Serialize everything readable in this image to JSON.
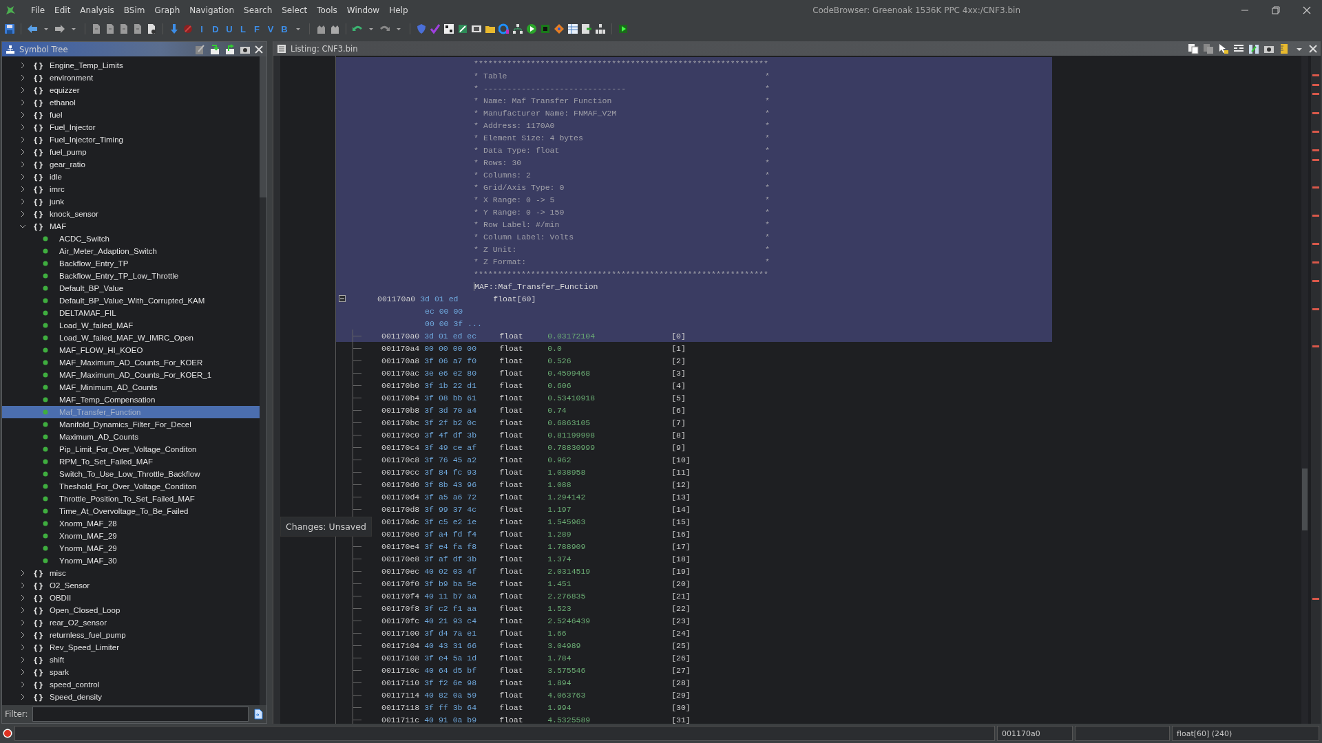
{
  "window": {
    "title": "CodeBrowser: Greenoak 1536K PPC 4xx:/CNF3.bin"
  },
  "menu": [
    "File",
    "Edit",
    "Analysis",
    "BSim",
    "Graph",
    "Navigation",
    "Search",
    "Select",
    "Tools",
    "Window",
    "Help"
  ],
  "toolbar": {
    "letters": [
      "I",
      "D",
      "U",
      "L",
      "F",
      "V",
      "B"
    ]
  },
  "symbol_tree": {
    "title": "Symbol Tree",
    "filter": {
      "label": "Filter:"
    },
    "items": [
      {
        "glyph": "{}",
        "label": "Engine_Temp_Limits",
        "expanded": false,
        "selected": false
      },
      {
        "glyph": "{}",
        "label": "environment",
        "expanded": false,
        "selected": false
      },
      {
        "glyph": "{}",
        "label": "equizzer",
        "expanded": false,
        "selected": false
      },
      {
        "glyph": "{}",
        "label": "ethanol",
        "expanded": false,
        "selected": false
      },
      {
        "glyph": "{}",
        "label": "fuel",
        "expanded": false,
        "selected": false
      },
      {
        "glyph": "{}",
        "label": "Fuel_Injector",
        "expanded": false,
        "selected": false
      },
      {
        "glyph": "{}",
        "label": "Fuel_Injector_Timing",
        "expanded": false,
        "selected": false
      },
      {
        "glyph": "{}",
        "label": "fuel_pump",
        "expanded": false,
        "selected": false
      },
      {
        "glyph": "{}",
        "label": "gear_ratio",
        "expanded": false,
        "selected": false
      },
      {
        "glyph": "{}",
        "label": "idle",
        "expanded": false,
        "selected": false
      },
      {
        "glyph": "{}",
        "label": "imrc",
        "expanded": false,
        "selected": false
      },
      {
        "glyph": "{}",
        "label": "junk",
        "expanded": false,
        "selected": false
      },
      {
        "glyph": "{}",
        "label": "knock_sensor",
        "expanded": false,
        "selected": false
      },
      {
        "glyph": "{}",
        "label": "MAF",
        "expanded": true,
        "selected": false,
        "children": [
          {
            "label": "ACDC_Switch",
            "selected": false
          },
          {
            "label": "Air_Meter_Adaption_Switch",
            "selected": false
          },
          {
            "label": "Backflow_Entry_TP",
            "selected": false
          },
          {
            "label": "Backflow_Entry_TP_Low_Throttle",
            "selected": false
          },
          {
            "label": "Default_BP_Value",
            "selected": false
          },
          {
            "label": "Default_BP_Value_With_Corrupted_KAM",
            "selected": false
          },
          {
            "label": "DELTAMAF_FIL",
            "selected": false
          },
          {
            "label": "Load_W_failed_MAF",
            "selected": false
          },
          {
            "label": "Load_W_failed_MAF_W_IMRC_Open",
            "selected": false
          },
          {
            "label": "MAF_FLOW_HI_KOEO",
            "selected": false
          },
          {
            "label": "MAF_Maximum_AD_Counts_For_KOER",
            "selected": false
          },
          {
            "label": "MAF_Maximum_AD_Counts_For_KOER_1",
            "selected": false
          },
          {
            "label": "MAF_Minimum_AD_Counts",
            "selected": false
          },
          {
            "label": "MAF_Temp_Compensation",
            "selected": false
          },
          {
            "label": "Maf_Transfer_Function",
            "selected": true
          },
          {
            "label": "Manifold_Dynamics_Filter_For_Decel",
            "selected": false
          },
          {
            "label": "Maximum_AD_Counts",
            "selected": false
          },
          {
            "label": "Pip_Limit_For_Over_Voltage_Conditon",
            "selected": false
          },
          {
            "label": "RPM_To_Set_Failed_MAF",
            "selected": false
          },
          {
            "label": "Switch_To_Use_Low_Throttle_Backflow",
            "selected": false
          },
          {
            "label": "Theshold_For_Over_Voltage_Conditon",
            "selected": false
          },
          {
            "label": "Throttle_Position_To_Set_Failed_MAF",
            "selected": false
          },
          {
            "label": "Time_At_Overvoltage_To_Be_Failed",
            "selected": false
          },
          {
            "label": "Xnorm_MAF_28",
            "selected": false
          },
          {
            "label": "Xnorm_MAF_29",
            "selected": false
          },
          {
            "label": "Ynorm_MAF_29",
            "selected": false
          },
          {
            "label": "Ynorm_MAF_30",
            "selected": false
          }
        ]
      },
      {
        "glyph": "{}",
        "label": "misc",
        "expanded": false,
        "selected": false
      },
      {
        "glyph": "{}",
        "label": "O2_Sensor",
        "expanded": false,
        "selected": false
      },
      {
        "glyph": "{}",
        "label": "OBDII",
        "expanded": false,
        "selected": false
      },
      {
        "glyph": "{}",
        "label": "Open_Closed_Loop",
        "expanded": false,
        "selected": false
      },
      {
        "glyph": "{}",
        "label": "rear_O2_sensor",
        "expanded": false,
        "selected": false
      },
      {
        "glyph": "{}",
        "label": "returnless_fuel_pump",
        "expanded": false,
        "selected": false
      },
      {
        "glyph": "{}",
        "label": "Rev_Speed_Limiter",
        "expanded": false,
        "selected": false
      },
      {
        "glyph": "{}",
        "label": "shift",
        "expanded": false,
        "selected": false
      },
      {
        "glyph": "{}",
        "label": "spark",
        "expanded": false,
        "selected": false
      },
      {
        "glyph": "{}",
        "label": "speed_control",
        "expanded": false,
        "selected": false
      },
      {
        "glyph": "{}",
        "label": "Speed_density",
        "expanded": false,
        "selected": false
      }
    ]
  },
  "listing": {
    "title": "Listing:  CNF3.bin",
    "tooltip": "Changes: Unsaved",
    "lines": [
      {
        "kind": "border",
        "text": "**************************************************************",
        "selected": true
      },
      {
        "kind": "comment",
        "left": "*",
        "text": "Table",
        "right": "*",
        "selected": true
      },
      {
        "kind": "comment",
        "left": "*",
        "text": "------------------------------",
        "right": "*",
        "selected": true
      },
      {
        "kind": "comment",
        "left": "*",
        "text": "Name: Maf Transfer Function",
        "right": "*",
        "selected": true
      },
      {
        "kind": "comment",
        "left": "*",
        "text": "Manufacturer Name: FNMAF_V2M",
        "right": "*",
        "selected": true
      },
      {
        "kind": "comment",
        "left": "*",
        "text": "Address: 1170A0",
        "right": "*",
        "selected": true
      },
      {
        "kind": "comment",
        "left": "*",
        "text": "Element Size: 4 bytes",
        "right": "*",
        "selected": true
      },
      {
        "kind": "comment",
        "left": "*",
        "text": "Data Type: float",
        "right": "*",
        "selected": true
      },
      {
        "kind": "comment",
        "left": "*",
        "text": "Rows: 30",
        "right": "*",
        "selected": true
      },
      {
        "kind": "comment",
        "left": "*",
        "text": "Columns: 2",
        "right": "*",
        "selected": true
      },
      {
        "kind": "comment",
        "left": "*",
        "text": "Grid/Axis Type: 0",
        "right": "*",
        "selected": true
      },
      {
        "kind": "comment",
        "left": "*",
        "text": "X Range: 0 -> 5",
        "right": "*",
        "selected": true
      },
      {
        "kind": "comment",
        "left": "*",
        "text": "Y Range: 0 -> 150",
        "right": "*",
        "selected": true
      },
      {
        "kind": "comment",
        "left": "*",
        "text": "Row Label: #/min",
        "right": "*",
        "selected": true
      },
      {
        "kind": "comment",
        "left": "*",
        "text": "Column Label: Volts",
        "right": "*",
        "selected": true
      },
      {
        "kind": "comment",
        "left": "*",
        "text": "Z Unit:",
        "right": "*",
        "selected": true
      },
      {
        "kind": "comment",
        "left": "*",
        "text": "Z Format:",
        "right": "*",
        "selected": true
      },
      {
        "kind": "border",
        "text": "**************************************************************",
        "selected": true
      },
      {
        "kind": "label",
        "text": "MAF::Maf_Transfer_Function",
        "selected": true
      },
      {
        "kind": "data",
        "address": "001170a0",
        "bytes": "3d 01 ed",
        "type": "float[60]",
        "selected": true
      },
      {
        "kind": "bytes",
        "bytes": "ec 00 00",
        "selected": true
      },
      {
        "kind": "bytes",
        "bytes": "00 00 3f ...",
        "selected": true
      },
      {
        "kind": "element",
        "address": "001170a0",
        "bytes": "3d 01 ed ec",
        "type": "float",
        "value": "0.03172104",
        "index": "[0]",
        "selected": true
      },
      {
        "kind": "element",
        "address": "001170a4",
        "bytes": "00 00 00 00",
        "type": "float",
        "value": "0.0",
        "index": "[1]",
        "selected": false
      },
      {
        "kind": "element",
        "address": "001170a8",
        "bytes": "3f 06 a7 f0",
        "type": "float",
        "value": "0.526",
        "index": "[2]",
        "selected": false
      },
      {
        "kind": "element",
        "address": "001170ac",
        "bytes": "3e e6 e2 80",
        "type": "float",
        "value": "0.4509468",
        "index": "[3]",
        "selected": false
      },
      {
        "kind": "element",
        "address": "001170b0",
        "bytes": "3f 1b 22 d1",
        "type": "float",
        "value": "0.606",
        "index": "[4]",
        "selected": false
      },
      {
        "kind": "element",
        "address": "001170b4",
        "bytes": "3f 08 bb 61",
        "type": "float",
        "value": "0.53410918",
        "index": "[5]",
        "selected": false
      },
      {
        "kind": "element",
        "address": "001170b8",
        "bytes": "3f 3d 70 a4",
        "type": "float",
        "value": "0.74",
        "index": "[6]",
        "selected": false
      },
      {
        "kind": "element",
        "address": "001170bc",
        "bytes": "3f 2f b2 0c",
        "type": "float",
        "value": "0.6863105",
        "index": "[7]",
        "selected": false
      },
      {
        "kind": "element",
        "address": "001170c0",
        "bytes": "3f 4f df 3b",
        "type": "float",
        "value": "0.81199998",
        "index": "[8]",
        "selected": false
      },
      {
        "kind": "element",
        "address": "001170c4",
        "bytes": "3f 49 ce af",
        "type": "float",
        "value": "0.78830999",
        "index": "[9]",
        "selected": false
      },
      {
        "kind": "element",
        "address": "001170c8",
        "bytes": "3f 76 45 a2",
        "type": "float",
        "value": "0.962",
        "index": "[10]",
        "selected": false
      },
      {
        "kind": "element",
        "address": "001170cc",
        "bytes": "3f 84 fc 93",
        "type": "float",
        "value": "1.038958",
        "index": "[11]",
        "selected": false
      },
      {
        "kind": "element",
        "address": "001170d0",
        "bytes": "3f 8b 43 96",
        "type": "float",
        "value": "1.088",
        "index": "[12]",
        "selected": false
      },
      {
        "kind": "element",
        "address": "001170d4",
        "bytes": "3f a5 a6 72",
        "type": "float",
        "value": "1.294142",
        "index": "[13]",
        "selected": false
      },
      {
        "kind": "element",
        "address": "001170d8",
        "bytes": "3f 99 37 4c",
        "type": "float",
        "value": "1.197",
        "index": "[14]",
        "selected": false
      },
      {
        "kind": "element",
        "address": "001170dc",
        "bytes": "3f c5 e2 1e",
        "type": "float",
        "value": "1.545963",
        "index": "[15]",
        "selected": false
      },
      {
        "kind": "element",
        "address": "001170e0",
        "bytes": "3f a4 fd f4",
        "type": "float",
        "value": "1.289",
        "index": "[16]",
        "selected": false
      },
      {
        "kind": "element",
        "address": "001170e4",
        "bytes": "3f e4 fa f8",
        "type": "float",
        "value": "1.788909",
        "index": "[17]",
        "selected": false
      },
      {
        "kind": "element",
        "address": "001170e8",
        "bytes": "3f af df 3b",
        "type": "float",
        "value": "1.374",
        "index": "[18]",
        "selected": false
      },
      {
        "kind": "element",
        "address": "001170ec",
        "bytes": "40 02 03 4f",
        "type": "float",
        "value": "2.0314519",
        "index": "[19]",
        "selected": false
      },
      {
        "kind": "element",
        "address": "001170f0",
        "bytes": "3f b9 ba 5e",
        "type": "float",
        "value": "1.451",
        "index": "[20]",
        "selected": false
      },
      {
        "kind": "element",
        "address": "001170f4",
        "bytes": "40 11 b7 aa",
        "type": "float",
        "value": "2.276835",
        "index": "[21]",
        "selected": false
      },
      {
        "kind": "element",
        "address": "001170f8",
        "bytes": "3f c2 f1 aa",
        "type": "float",
        "value": "1.523",
        "index": "[22]",
        "selected": false
      },
      {
        "kind": "element",
        "address": "001170fc",
        "bytes": "40 21 93 c4",
        "type": "float",
        "value": "2.5246439",
        "index": "[23]",
        "selected": false
      },
      {
        "kind": "element",
        "address": "00117100",
        "bytes": "3f d4 7a e1",
        "type": "float",
        "value": "1.66",
        "index": "[24]",
        "selected": false
      },
      {
        "kind": "element",
        "address": "00117104",
        "bytes": "40 43 31 66",
        "type": "float",
        "value": "3.04989",
        "index": "[25]",
        "selected": false
      },
      {
        "kind": "element",
        "address": "00117108",
        "bytes": "3f e4 5a 1d",
        "type": "float",
        "value": "1.784",
        "index": "[26]",
        "selected": false
      },
      {
        "kind": "element",
        "address": "0011710c",
        "bytes": "40 64 d5 bf",
        "type": "float",
        "value": "3.575546",
        "index": "[27]",
        "selected": false
      },
      {
        "kind": "element",
        "address": "00117110",
        "bytes": "3f f2 6e 98",
        "type": "float",
        "value": "1.894",
        "index": "[28]",
        "selected": false
      },
      {
        "kind": "element",
        "address": "00117114",
        "bytes": "40 82 0a 59",
        "type": "float",
        "value": "4.063763",
        "index": "[29]",
        "selected": false
      },
      {
        "kind": "element",
        "address": "00117118",
        "bytes": "3f ff 3b 64",
        "type": "float",
        "value": "1.994",
        "index": "[30]",
        "selected": false
      },
      {
        "kind": "element",
        "address": "0011711c",
        "bytes": "40 91 0a b9",
        "type": "float",
        "value": "4.5325589",
        "index": "[31]",
        "selected": false
      }
    ]
  },
  "status_bar": {
    "address": "001170a0",
    "data_type": "float[60] (240)"
  }
}
